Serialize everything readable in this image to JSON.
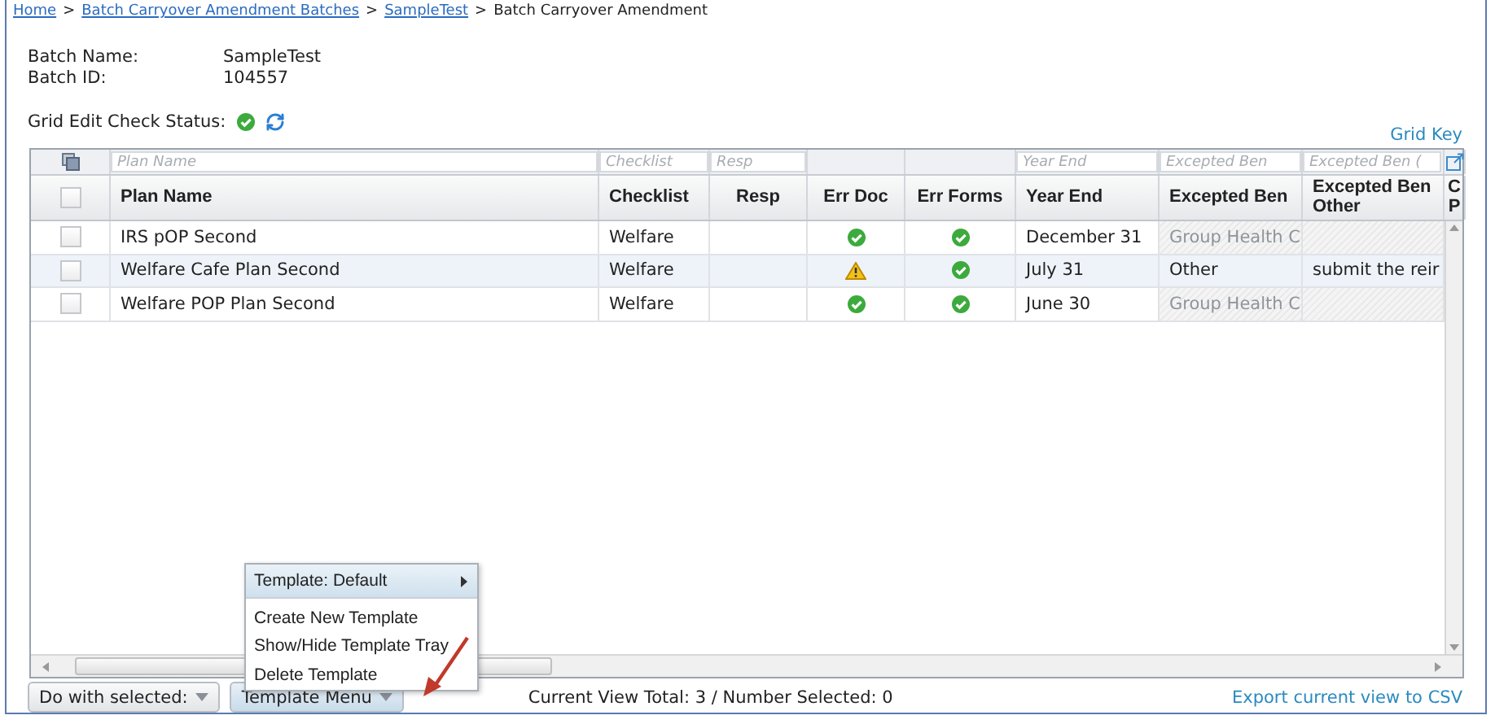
{
  "breadcrumb": [
    {
      "kind": "link",
      "label": "Home"
    },
    {
      "kind": "separator",
      "label": ">"
    },
    {
      "kind": "link",
      "label": "Batch Carryover Amendment Batches"
    },
    {
      "kind": "separator",
      "label": ">"
    },
    {
      "kind": "link",
      "label": "SampleTest"
    },
    {
      "kind": "separator",
      "label": ">"
    },
    {
      "kind": "current",
      "label": "Batch Carryover Amendment"
    }
  ],
  "batch": [
    {
      "label": "Batch Name:",
      "value": "SampleTest"
    },
    {
      "label": "Batch ID:",
      "value": "104557"
    }
  ],
  "edit_check": {
    "label": "Grid Edit Check Status:",
    "passed": true
  },
  "grid_key": "Grid Key",
  "grid": {
    "filters": [
      {
        "kind": "input",
        "placeholder": "Plan Name"
      },
      {
        "kind": "input",
        "placeholder": "Checklist"
      },
      {
        "kind": "input",
        "placeholder": "Resp"
      },
      {
        "kind": "blank"
      },
      {
        "kind": "blank"
      },
      {
        "kind": "input",
        "placeholder": "Year End"
      },
      {
        "kind": "input",
        "placeholder": "Excepted Ben"
      },
      {
        "kind": "input",
        "placeholder": "Excepted Ben ("
      }
    ],
    "header_checked": false,
    "columns": [
      "Plan Name",
      "Checklist",
      "Resp",
      "Err Doc",
      "Err Forms",
      "Year End",
      "Excepted Ben",
      "Excepted Ben Other",
      "C P"
    ],
    "rows": [
      {
        "checked": false,
        "highlighted": false,
        "cells": [
          {
            "kind": "text",
            "text": "IRS pOP Second"
          },
          {
            "kind": "text",
            "text": "Welfare"
          },
          {
            "kind": "text"
          },
          {
            "kind": "ok"
          },
          {
            "kind": "ok"
          },
          {
            "kind": "text",
            "text": "December 31"
          },
          {
            "kind": "disabled",
            "text": "Group Health C"
          },
          {
            "kind": "disabled"
          }
        ]
      },
      {
        "checked": false,
        "highlighted": true,
        "cells": [
          {
            "kind": "text",
            "text": "Welfare Cafe Plan Second"
          },
          {
            "kind": "text",
            "text": "Welfare"
          },
          {
            "kind": "text"
          },
          {
            "kind": "warning"
          },
          {
            "kind": "ok"
          },
          {
            "kind": "text",
            "text": "July 31"
          },
          {
            "kind": "text",
            "text": "Other"
          },
          {
            "kind": "text",
            "text": "submit the reir"
          }
        ]
      },
      {
        "checked": false,
        "highlighted": false,
        "cells": [
          {
            "kind": "text",
            "text": "Welfare POP Plan Second"
          },
          {
            "kind": "text",
            "text": "Welfare"
          },
          {
            "kind": "text"
          },
          {
            "kind": "ok"
          },
          {
            "kind": "ok"
          },
          {
            "kind": "text",
            "text": "June 30"
          },
          {
            "kind": "disabled",
            "text": "Group Health C"
          },
          {
            "kind": "disabled"
          }
        ]
      }
    ]
  },
  "template_menu": {
    "items": [
      {
        "label": "Template: Default",
        "submenu": true,
        "selected": true
      },
      {
        "label": "Create New Template",
        "submenu": false,
        "selected": false
      },
      {
        "label": "Show/Hide Template Tray",
        "submenu": false,
        "selected": false
      },
      {
        "label": "Delete Template",
        "submenu": false,
        "selected": false
      }
    ]
  },
  "footer": {
    "buttons": [
      {
        "label": "Do with selected:",
        "active": false
      },
      {
        "label": "Template Menu",
        "active": true
      }
    ],
    "status": "Current View Total: 3 / Number Selected: 0",
    "export_link": "Export current view to CSV"
  }
}
